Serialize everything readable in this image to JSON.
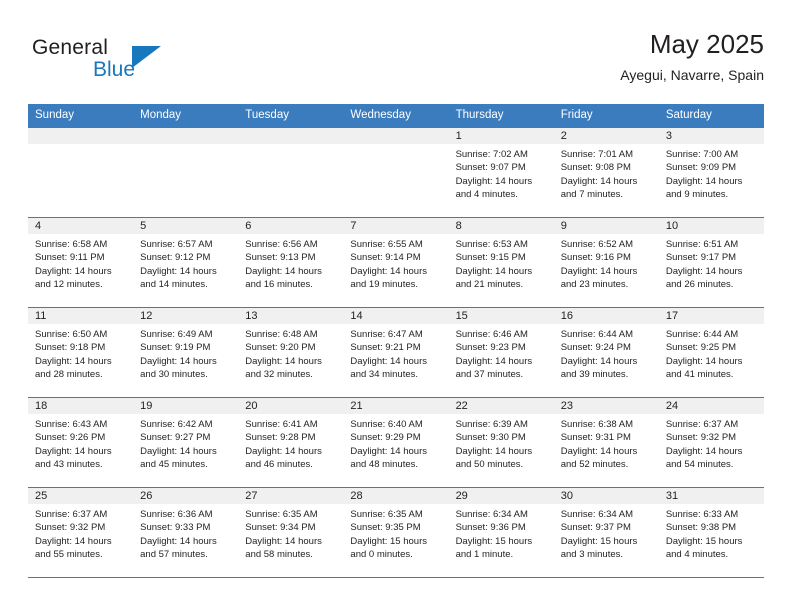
{
  "logo": {
    "word_one": "General",
    "word_two": "Blue",
    "accent_color": "#1878be",
    "triangle_icon": "triangle-icon"
  },
  "header": {
    "title": "May 2025",
    "subtitle": "Ayegui, Navarre, Spain"
  },
  "calendar": {
    "header_color": "#3b7cbf",
    "day_band_color": "#f0f0f0",
    "weekdays": [
      "Sunday",
      "Monday",
      "Tuesday",
      "Wednesday",
      "Thursday",
      "Friday",
      "Saturday"
    ],
    "weeks": [
      [
        {
          "day": "",
          "sunrise": "",
          "sunset": "",
          "daylight": ""
        },
        {
          "day": "",
          "sunrise": "",
          "sunset": "",
          "daylight": ""
        },
        {
          "day": "",
          "sunrise": "",
          "sunset": "",
          "daylight": ""
        },
        {
          "day": "",
          "sunrise": "",
          "sunset": "",
          "daylight": ""
        },
        {
          "day": "1",
          "sunrise": "Sunrise: 7:02 AM",
          "sunset": "Sunset: 9:07 PM",
          "daylight": "Daylight: 14 hours and 4 minutes."
        },
        {
          "day": "2",
          "sunrise": "Sunrise: 7:01 AM",
          "sunset": "Sunset: 9:08 PM",
          "daylight": "Daylight: 14 hours and 7 minutes."
        },
        {
          "day": "3",
          "sunrise": "Sunrise: 7:00 AM",
          "sunset": "Sunset: 9:09 PM",
          "daylight": "Daylight: 14 hours and 9 minutes."
        }
      ],
      [
        {
          "day": "4",
          "sunrise": "Sunrise: 6:58 AM",
          "sunset": "Sunset: 9:11 PM",
          "daylight": "Daylight: 14 hours and 12 minutes."
        },
        {
          "day": "5",
          "sunrise": "Sunrise: 6:57 AM",
          "sunset": "Sunset: 9:12 PM",
          "daylight": "Daylight: 14 hours and 14 minutes."
        },
        {
          "day": "6",
          "sunrise": "Sunrise: 6:56 AM",
          "sunset": "Sunset: 9:13 PM",
          "daylight": "Daylight: 14 hours and 16 minutes."
        },
        {
          "day": "7",
          "sunrise": "Sunrise: 6:55 AM",
          "sunset": "Sunset: 9:14 PM",
          "daylight": "Daylight: 14 hours and 19 minutes."
        },
        {
          "day": "8",
          "sunrise": "Sunrise: 6:53 AM",
          "sunset": "Sunset: 9:15 PM",
          "daylight": "Daylight: 14 hours and 21 minutes."
        },
        {
          "day": "9",
          "sunrise": "Sunrise: 6:52 AM",
          "sunset": "Sunset: 9:16 PM",
          "daylight": "Daylight: 14 hours and 23 minutes."
        },
        {
          "day": "10",
          "sunrise": "Sunrise: 6:51 AM",
          "sunset": "Sunset: 9:17 PM",
          "daylight": "Daylight: 14 hours and 26 minutes."
        }
      ],
      [
        {
          "day": "11",
          "sunrise": "Sunrise: 6:50 AM",
          "sunset": "Sunset: 9:18 PM",
          "daylight": "Daylight: 14 hours and 28 minutes."
        },
        {
          "day": "12",
          "sunrise": "Sunrise: 6:49 AM",
          "sunset": "Sunset: 9:19 PM",
          "daylight": "Daylight: 14 hours and 30 minutes."
        },
        {
          "day": "13",
          "sunrise": "Sunrise: 6:48 AM",
          "sunset": "Sunset: 9:20 PM",
          "daylight": "Daylight: 14 hours and 32 minutes."
        },
        {
          "day": "14",
          "sunrise": "Sunrise: 6:47 AM",
          "sunset": "Sunset: 9:21 PM",
          "daylight": "Daylight: 14 hours and 34 minutes."
        },
        {
          "day": "15",
          "sunrise": "Sunrise: 6:46 AM",
          "sunset": "Sunset: 9:23 PM",
          "daylight": "Daylight: 14 hours and 37 minutes."
        },
        {
          "day": "16",
          "sunrise": "Sunrise: 6:44 AM",
          "sunset": "Sunset: 9:24 PM",
          "daylight": "Daylight: 14 hours and 39 minutes."
        },
        {
          "day": "17",
          "sunrise": "Sunrise: 6:44 AM",
          "sunset": "Sunset: 9:25 PM",
          "daylight": "Daylight: 14 hours and 41 minutes."
        }
      ],
      [
        {
          "day": "18",
          "sunrise": "Sunrise: 6:43 AM",
          "sunset": "Sunset: 9:26 PM",
          "daylight": "Daylight: 14 hours and 43 minutes."
        },
        {
          "day": "19",
          "sunrise": "Sunrise: 6:42 AM",
          "sunset": "Sunset: 9:27 PM",
          "daylight": "Daylight: 14 hours and 45 minutes."
        },
        {
          "day": "20",
          "sunrise": "Sunrise: 6:41 AM",
          "sunset": "Sunset: 9:28 PM",
          "daylight": "Daylight: 14 hours and 46 minutes."
        },
        {
          "day": "21",
          "sunrise": "Sunrise: 6:40 AM",
          "sunset": "Sunset: 9:29 PM",
          "daylight": "Daylight: 14 hours and 48 minutes."
        },
        {
          "day": "22",
          "sunrise": "Sunrise: 6:39 AM",
          "sunset": "Sunset: 9:30 PM",
          "daylight": "Daylight: 14 hours and 50 minutes."
        },
        {
          "day": "23",
          "sunrise": "Sunrise: 6:38 AM",
          "sunset": "Sunset: 9:31 PM",
          "daylight": "Daylight: 14 hours and 52 minutes."
        },
        {
          "day": "24",
          "sunrise": "Sunrise: 6:37 AM",
          "sunset": "Sunset: 9:32 PM",
          "daylight": "Daylight: 14 hours and 54 minutes."
        }
      ],
      [
        {
          "day": "25",
          "sunrise": "Sunrise: 6:37 AM",
          "sunset": "Sunset: 9:32 PM",
          "daylight": "Daylight: 14 hours and 55 minutes."
        },
        {
          "day": "26",
          "sunrise": "Sunrise: 6:36 AM",
          "sunset": "Sunset: 9:33 PM",
          "daylight": "Daylight: 14 hours and 57 minutes."
        },
        {
          "day": "27",
          "sunrise": "Sunrise: 6:35 AM",
          "sunset": "Sunset: 9:34 PM",
          "daylight": "Daylight: 14 hours and 58 minutes."
        },
        {
          "day": "28",
          "sunrise": "Sunrise: 6:35 AM",
          "sunset": "Sunset: 9:35 PM",
          "daylight": "Daylight: 15 hours and 0 minutes."
        },
        {
          "day": "29",
          "sunrise": "Sunrise: 6:34 AM",
          "sunset": "Sunset: 9:36 PM",
          "daylight": "Daylight: 15 hours and 1 minute."
        },
        {
          "day": "30",
          "sunrise": "Sunrise: 6:34 AM",
          "sunset": "Sunset: 9:37 PM",
          "daylight": "Daylight: 15 hours and 3 minutes."
        },
        {
          "day": "31",
          "sunrise": "Sunrise: 6:33 AM",
          "sunset": "Sunset: 9:38 PM",
          "daylight": "Daylight: 15 hours and 4 minutes."
        }
      ]
    ]
  }
}
